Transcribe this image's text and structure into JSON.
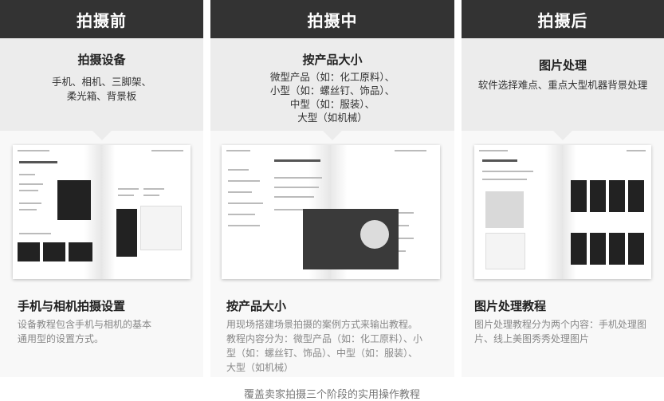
{
  "columns": [
    {
      "header": "拍摄前",
      "subtitle": "拍摄设备",
      "subtitle_lines": [
        "手机、相机、三脚架、",
        "柔光箱、背景板"
      ],
      "card_title": "手机与相机拍摄设置",
      "card_desc": "设备教程包含手机与相机的基本通用型的设置方式。"
    },
    {
      "header": "拍摄中",
      "subtitle": "按产品大小",
      "subtitle_lines": [
        "微型产品（如：化工原料）、",
        "小型（如：螺丝钉、饰品）、",
        "中型（如：服装）、",
        "大型（如机械）"
      ],
      "card_title": "按产品大小",
      "card_desc": "用现场搭建场景拍摄的案例方式来输出教程。教程内容分为：微型产品（如：化工原料）、小型（如：螺丝钉、饰品）、中型（如：服装）、大型（如机械）"
    },
    {
      "header": "拍摄后",
      "subtitle": "图片处理",
      "subtitle_lines": [
        "软件选择难点、重点大型机器背景处理"
      ],
      "card_title": "图片处理教程",
      "card_desc": "图片处理教程分为两个内容：手机处理图片、线上美图秀秀处理图片"
    }
  ],
  "caption": "覆盖卖家拍摄三个阶段的实用操作教程",
  "colors": {
    "header_bg": "#333333",
    "top_bg": "#ececec",
    "card_bg": "#f8f8f8"
  }
}
